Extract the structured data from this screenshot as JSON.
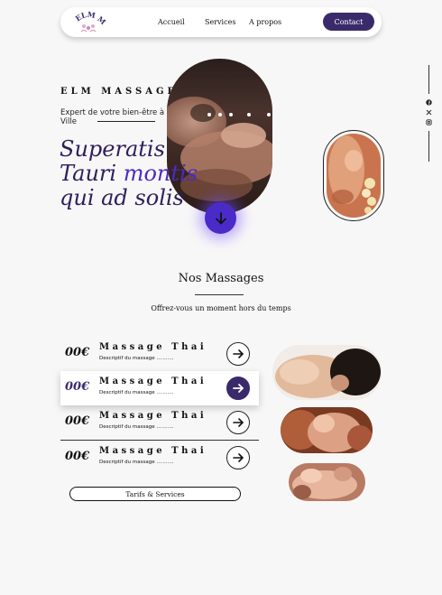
{
  "header": {
    "logo_text": "ELM MASSAGE",
    "nav": [
      "Accueil",
      "Services",
      "A propos"
    ],
    "contact_label": "Contact"
  },
  "social": [
    "facebook-icon",
    "x-icon",
    "instagram-icon"
  ],
  "hero": {
    "brand": "ELM MASSAGE",
    "tagline": "Expert de votre bien-être à Ville",
    "title_line1": "Superatis",
    "title_line2_a": "Tauri",
    "title_line2_b": "montis",
    "title_line3": "qui ad solis"
  },
  "services": {
    "title": "Nos Massages",
    "subtitle": "Offrez-vous un moment hors du temps",
    "items": [
      {
        "price": "00€",
        "name": "Massage Thai",
        "desc": "Descriptif du massage ..........."
      },
      {
        "price": "00€",
        "name": "Massage Thai",
        "desc": "Descriptif du massage ..........."
      },
      {
        "price": "00€",
        "name": "Massage Thai",
        "desc": "Descriptif du massage ..........."
      },
      {
        "price": "00€",
        "name": "Massage Thai",
        "desc": "Descriptif du massage ..........."
      }
    ],
    "cta": "Tarifs & Services"
  },
  "colors": {
    "accent": "#3b2a6b",
    "accent_bright": "#4a2bc8",
    "background": "#f8f7f7"
  }
}
